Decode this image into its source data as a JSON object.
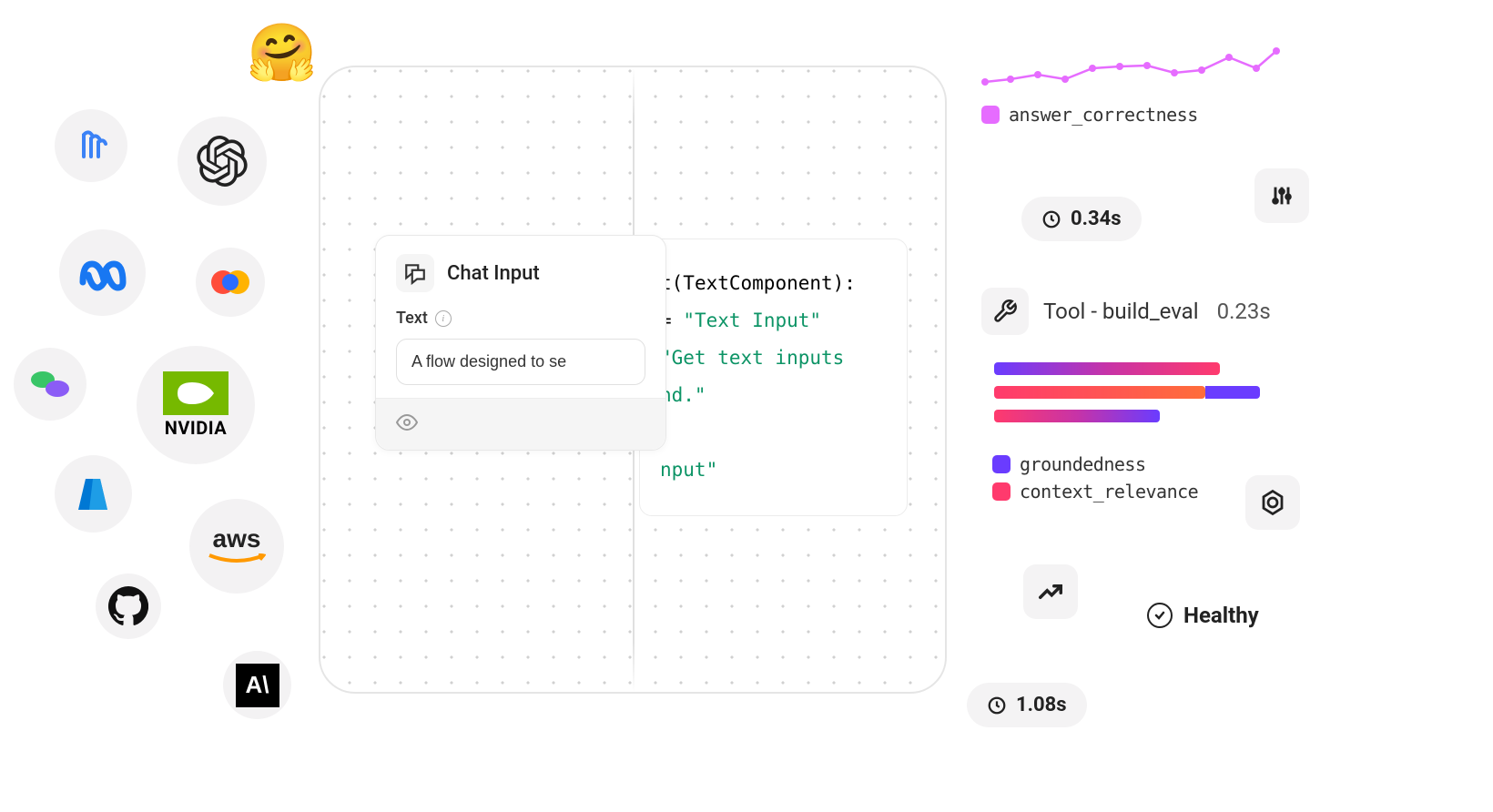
{
  "integrations": {
    "huggingface": "🤗",
    "nvidia_label": "NVIDIA",
    "aws_label": "aws"
  },
  "chat_card": {
    "title": "Chat Input",
    "field_label": "Text",
    "field_value": "A flow designed to se"
  },
  "code": {
    "line1_a": "t",
    "line1_b": "(TextComponent):",
    "line2_a": "=",
    "line2_b": "\"Text Input\"",
    "line3": "\"Get text inputs",
    "line4": "nd.\"",
    "line5": "nput\""
  },
  "chart_data": {
    "type": "line",
    "sparkline": {
      "series_name": "answer_correctness",
      "color": "#e66cff",
      "values": [
        50,
        47,
        42,
        47,
        35,
        33,
        32,
        40,
        37,
        23,
        35,
        16
      ]
    },
    "bars": {
      "type": "bar",
      "orientation": "horizontal",
      "series": [
        {
          "name": "groundedness",
          "color": "#6a3cff",
          "values": [
            248,
            60,
            0
          ]
        },
        {
          "name": "context_relevance",
          "color": "#ff3a6d",
          "values": [
            248,
            232,
            182
          ]
        }
      ]
    }
  },
  "metrics": {
    "time1": "0.34s",
    "tool_label": "Tool - build_eval",
    "tool_time": "0.23s",
    "status": "Healthy",
    "time2": "1.08s"
  },
  "legends": {
    "sparkline": "answer_correctness",
    "bars_a": "groundedness",
    "bars_b": "context_relevance"
  }
}
